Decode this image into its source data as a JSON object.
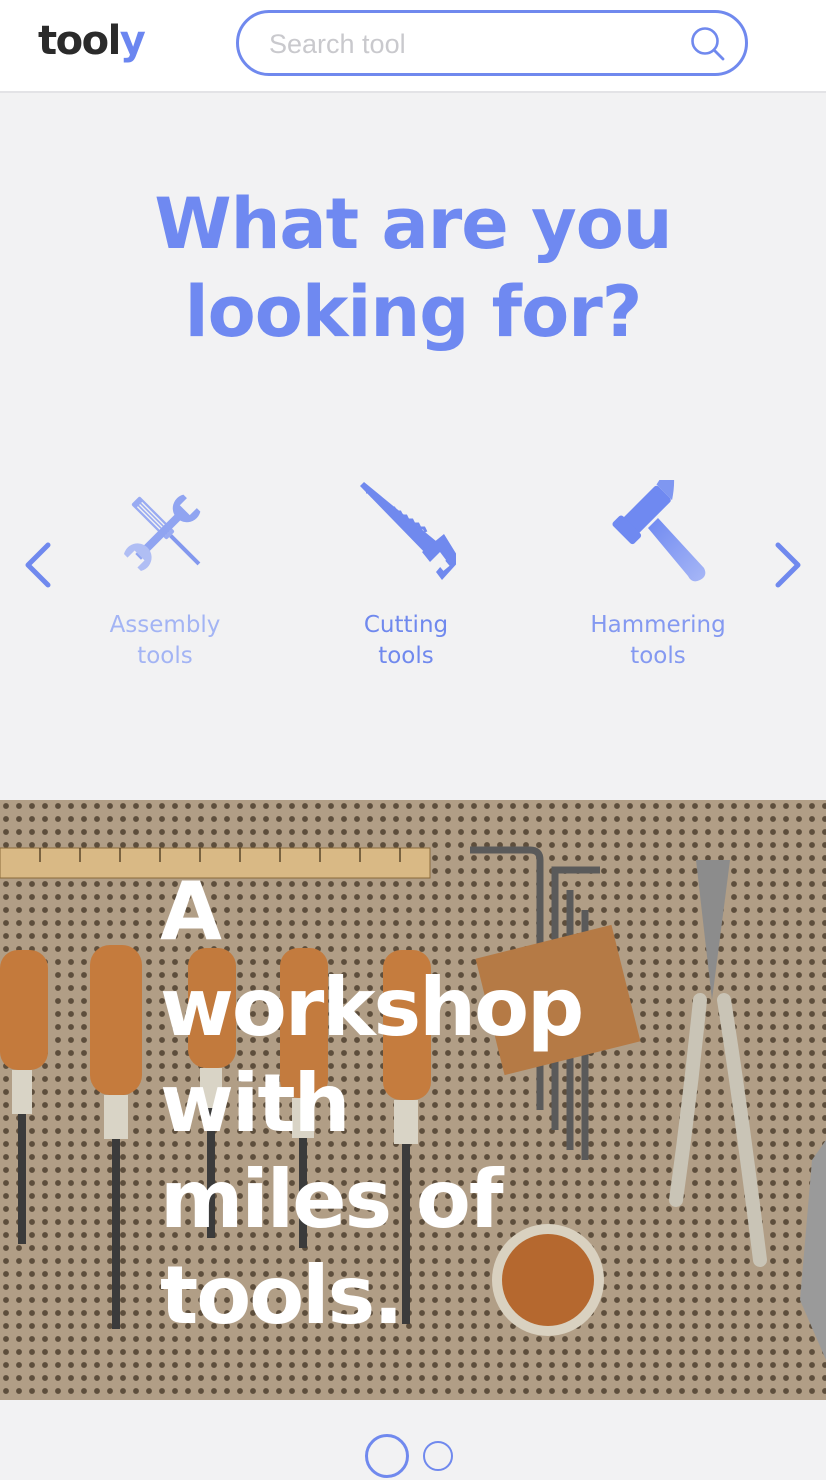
{
  "header": {
    "logo_main": "tool",
    "logo_accent": "y",
    "search_placeholder": "Search tool",
    "search_value": ""
  },
  "hero": {
    "title_line1": "What are you",
    "title_line2": "looking for?"
  },
  "categories": [
    {
      "label_line1": "Assembly",
      "label_line2": "tools",
      "icon": "wrench-screwdriver-icon"
    },
    {
      "label_line1": "Cutting",
      "label_line2": "tools",
      "icon": "saw-icon"
    },
    {
      "label_line1": "Hammering",
      "label_line2": "tools",
      "icon": "hammer-icon"
    }
  ],
  "banner": {
    "lines": [
      "A",
      "workshop",
      "with",
      "miles of",
      "tools."
    ]
  },
  "pagination": {
    "active_index": 1,
    "count": 2
  },
  "colors": {
    "accent": "#6f89f1",
    "logo_dark": "#2b2b2b",
    "background": "#f2f2f3"
  }
}
